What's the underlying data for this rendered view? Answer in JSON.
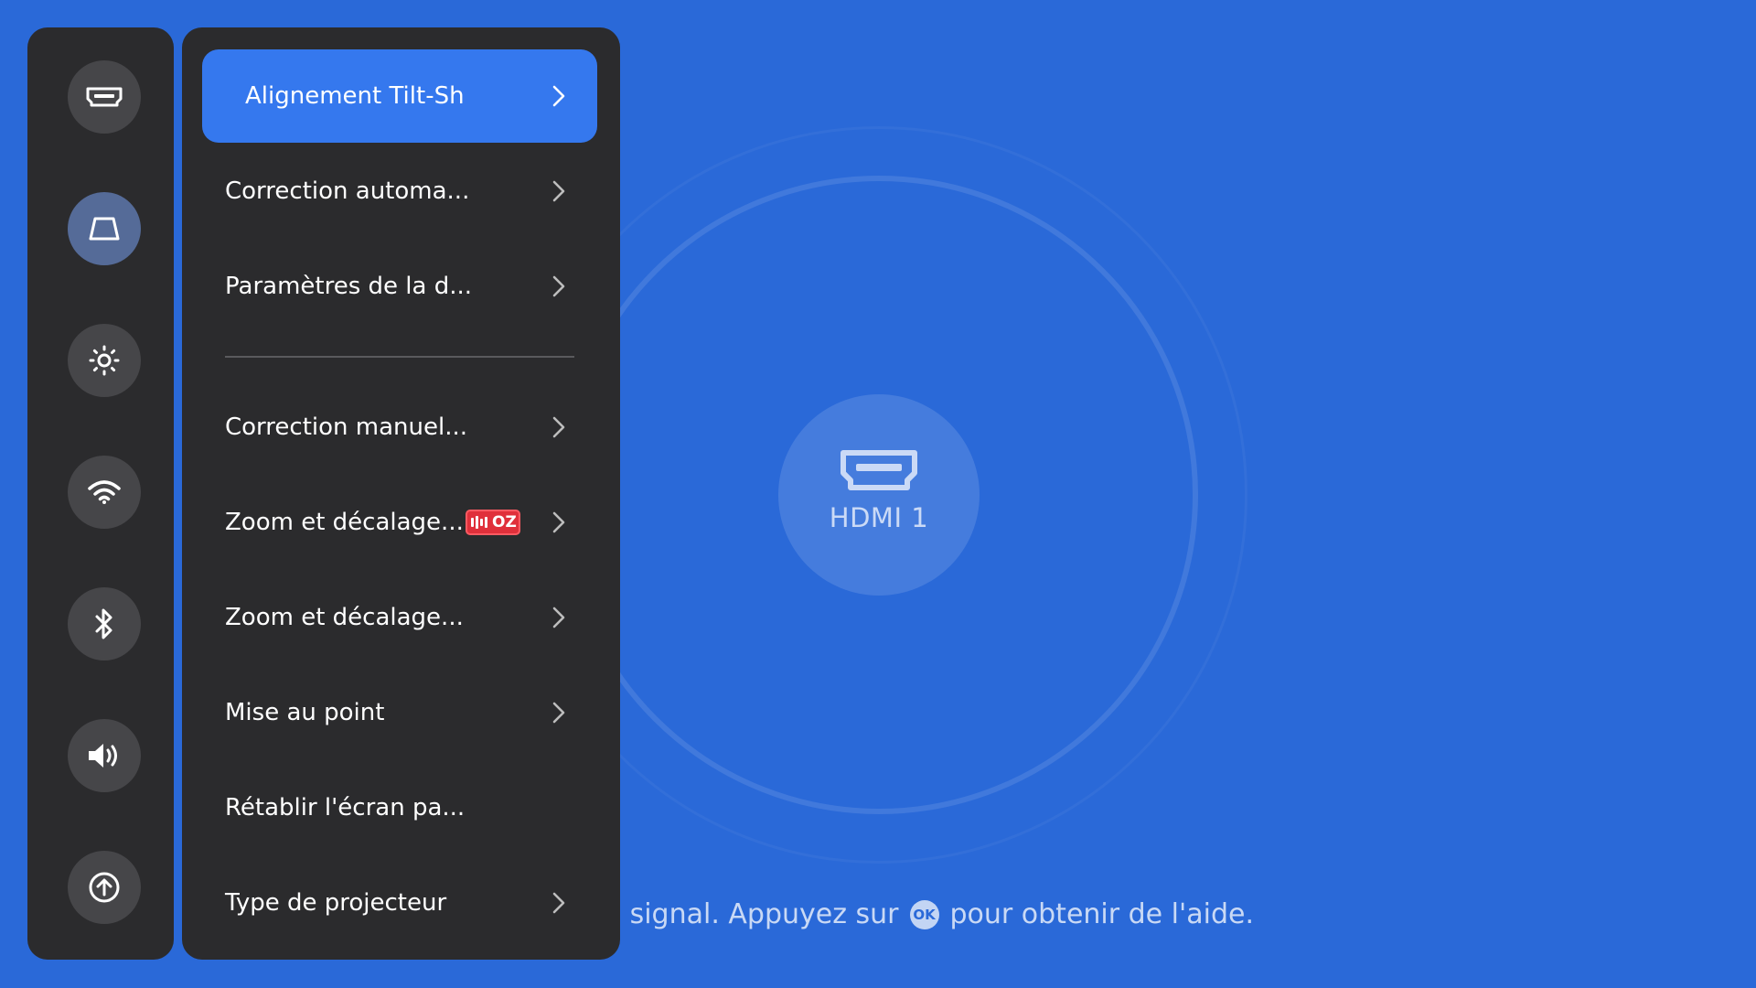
{
  "source": {
    "label": "HDMI 1",
    "icon": "hdmi-icon"
  },
  "status": {
    "message_before": "Aucun signal. Appuyez sur",
    "ok_key": "OK",
    "message_after": "pour obtenir de l'aide."
  },
  "rail": {
    "items": [
      {
        "icon": "hdmi-icon",
        "active": false
      },
      {
        "icon": "keystone-icon",
        "active": true
      },
      {
        "icon": "brightness-icon",
        "active": false
      },
      {
        "icon": "wifi-icon",
        "active": false
      },
      {
        "icon": "bluetooth-icon",
        "active": false
      },
      {
        "icon": "volume-icon",
        "active": false
      },
      {
        "icon": "update-icon",
        "active": false
      }
    ]
  },
  "menu": {
    "items": [
      {
        "label": "Alignement Tilt-Sh",
        "chevron": true,
        "active": true
      },
      {
        "label": "Correction automa...",
        "chevron": true
      },
      {
        "label": "Paramètres de la d...",
        "chevron": true
      },
      {
        "label": "Correction manuel...",
        "chevron": true
      },
      {
        "label": "Zoom et décalage...",
        "chevron": true,
        "badge": "OZ"
      },
      {
        "label": "Zoom et décalage...",
        "chevron": true
      },
      {
        "label": "Mise au point",
        "chevron": true
      },
      {
        "label": "Rétablir l'écran pa...",
        "chevron": false
      },
      {
        "label": "Type de projecteur",
        "chevron": true
      }
    ]
  },
  "colors": {
    "background": "#2a69d8",
    "panel": "#2b2b2d",
    "highlight": "#3578ee",
    "badge": "#e0303b"
  }
}
